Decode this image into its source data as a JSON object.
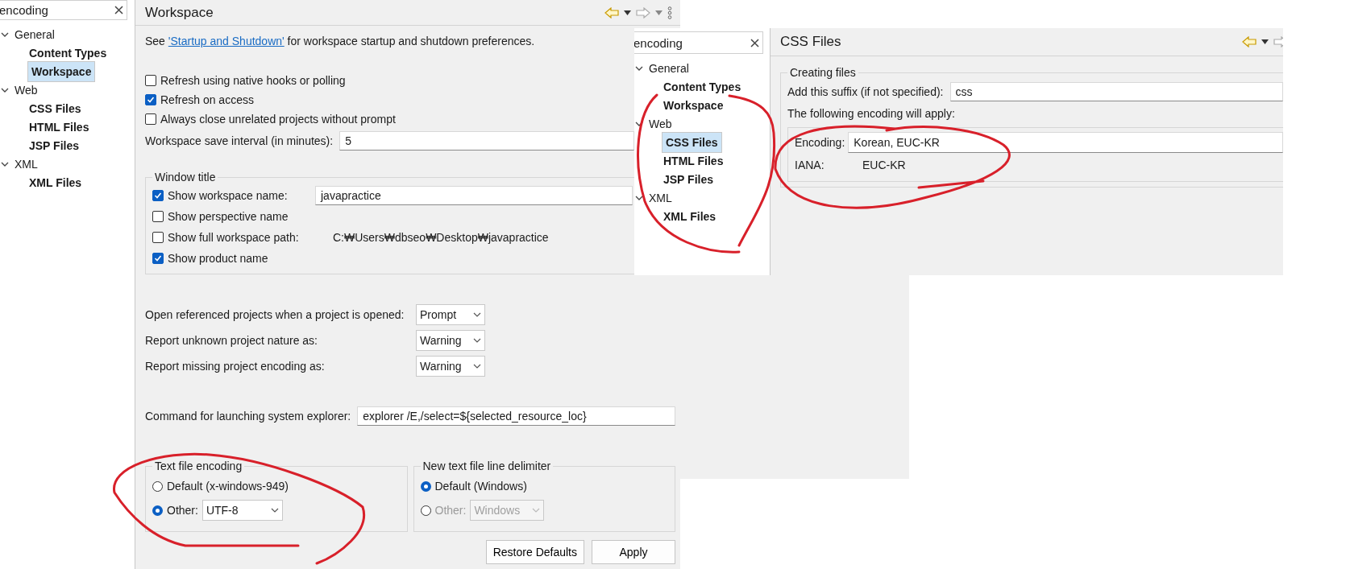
{
  "left_window": {
    "tree_search": {
      "value": "encoding"
    },
    "tree": [
      {
        "label": "General",
        "expanded": true,
        "selected": false,
        "children": [
          {
            "label": "Content Types",
            "selected": false
          },
          {
            "label": "Workspace",
            "selected": true
          }
        ]
      },
      {
        "label": "Web",
        "expanded": true,
        "selected": false,
        "children": [
          {
            "label": "CSS Files",
            "selected": false
          },
          {
            "label": "HTML Files",
            "selected": false
          },
          {
            "label": "JSP Files",
            "selected": false
          }
        ]
      },
      {
        "label": "XML",
        "expanded": true,
        "selected": false,
        "children": [
          {
            "label": "XML Files",
            "selected": false
          }
        ]
      }
    ],
    "page": {
      "title": "Workspace",
      "intro": {
        "before": "See ",
        "link": "'Startup and Shutdown'",
        "after": " for workspace startup and shutdown preferences."
      },
      "checkboxes": [
        {
          "label": "Refresh using native hooks or polling",
          "checked": false
        },
        {
          "label": "Refresh on access",
          "checked": true
        },
        {
          "label": "Always close unrelated projects without prompt",
          "checked": false
        }
      ],
      "save_interval": {
        "label": "Workspace save interval (in minutes):",
        "value": "5"
      },
      "window_title": {
        "title": "Window title",
        "rows": [
          {
            "label": "Show workspace name:",
            "checked": true,
            "value": "javapractice"
          },
          {
            "label": "Show perspective name",
            "checked": false
          },
          {
            "label": "Show full workspace path:",
            "checked": false,
            "path": "C:₩Users₩dbseo₩Desktop₩javapractice"
          },
          {
            "label": "Show product name",
            "checked": true
          }
        ]
      },
      "selects": [
        {
          "label": "Open referenced projects when a project is opened:",
          "value": "Prompt"
        },
        {
          "label": "Report unknown project nature as:",
          "value": "Warning"
        },
        {
          "label": "Report missing project encoding as:",
          "value": "Warning"
        }
      ],
      "explorer_command": {
        "label": "Command for launching system explorer:",
        "value": "explorer /E,/select=${selected_resource_loc}"
      },
      "text_file_encoding": {
        "title": "Text file encoding",
        "options": [
          {
            "label": "Default (x-windows-949)",
            "selected": false,
            "disabled": false
          },
          {
            "label": "Other:",
            "selected": true,
            "value": "UTF-8",
            "disabled": false
          }
        ]
      },
      "line_delimiter": {
        "title": "New text file line delimiter",
        "options": [
          {
            "label": "Default (Windows)",
            "selected": true,
            "disabled": false
          },
          {
            "label": "Other:",
            "selected": false,
            "value": "Windows",
            "disabled": true
          }
        ]
      },
      "buttons": [
        "Restore Defaults",
        "Apply"
      ]
    }
  },
  "right_window": {
    "tree_search": {
      "value": "encoding"
    },
    "tree": [
      {
        "label": "General",
        "expanded": true,
        "selected": false,
        "children": [
          {
            "label": "Content Types",
            "selected": false
          },
          {
            "label": "Workspace",
            "selected": false
          }
        ]
      },
      {
        "label": "Web",
        "expanded": true,
        "selected": false,
        "children": [
          {
            "label": "CSS Files",
            "selected": true
          },
          {
            "label": "HTML Files",
            "selected": false
          },
          {
            "label": "JSP Files",
            "selected": false
          }
        ]
      },
      {
        "label": "XML",
        "expanded": true,
        "selected": false,
        "children": [
          {
            "label": "XML Files",
            "selected": false
          }
        ]
      }
    ],
    "page": {
      "title": "CSS Files",
      "group_title": "Creating files",
      "suffix": {
        "label": "Add this suffix (if not specified):",
        "value": "css"
      },
      "encoding_note": "The following encoding will apply:",
      "encoding": {
        "label": "Encoding:",
        "value": "Korean, EUC-KR"
      },
      "iana": {
        "label": "IANA:",
        "value": "EUC-KR"
      }
    }
  }
}
